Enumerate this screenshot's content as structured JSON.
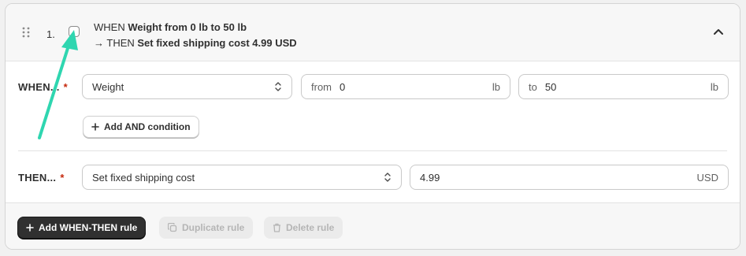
{
  "rule": {
    "number": "1.",
    "summary_line1_prefix": "WHEN ",
    "summary_line1_bold": "Weight from 0 lb to 50 lb",
    "summary_line2_prefix": "→ THEN ",
    "summary_line2_bold": "Set fixed shipping cost 4.99 USD",
    "checked": false
  },
  "when": {
    "label": "WHEN...",
    "required_mark": "*",
    "condition_select": "Weight",
    "from_prefix": "from",
    "from_value": "0",
    "from_unit": "lb",
    "to_prefix": "to",
    "to_value": "50",
    "to_unit": "lb",
    "add_and_label": "Add AND condition"
  },
  "then": {
    "label": "THEN...",
    "required_mark": "*",
    "action_select": "Set fixed shipping cost",
    "amount_value": "4.99",
    "amount_unit": "USD"
  },
  "footer": {
    "add_rule_label": "Add WHEN-THEN rule",
    "duplicate_label": "Duplicate rule",
    "delete_label": "Delete rule"
  },
  "colors": {
    "annotation_arrow": "#2fd6b0",
    "required": "#c5280c",
    "primary_button": "#303030"
  },
  "icons": [
    "drag-handle-icon",
    "chevron-up-icon",
    "select-arrows-icon",
    "plus-icon",
    "duplicate-icon",
    "trash-icon"
  ]
}
